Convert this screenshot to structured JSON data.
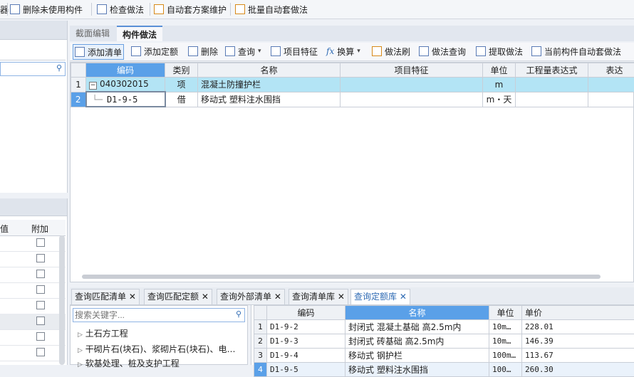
{
  "toolbar": {
    "items": [
      {
        "label": "删除未使用构件",
        "icon": "delete-unused-icon"
      },
      {
        "label": "检查做法",
        "icon": "check-method-icon"
      },
      {
        "label": "自动套方案维护",
        "icon": "auto-plan-icon"
      },
      {
        "label": "批量自动套做法",
        "icon": "batch-auto-icon"
      }
    ],
    "partial_first": "器"
  },
  "left_top": {
    "header": "",
    "search_placeholder": ""
  },
  "left_bottom": {
    "headers": [
      "值",
      "附加"
    ],
    "rows": 9
  },
  "main_tabs": [
    {
      "label": "截面编辑",
      "active": false
    },
    {
      "label": "构件做法",
      "active": true
    }
  ],
  "method_toolbar": [
    {
      "label": "添加清单",
      "icon": "add-list-icon"
    },
    {
      "label": "添加定额",
      "icon": "add-quota-icon"
    },
    {
      "label": "删除",
      "icon": "delete-icon"
    },
    {
      "label": "查询",
      "icon": "query-icon"
    },
    {
      "label": "项目特征",
      "icon": "feature-icon"
    },
    {
      "label": "换算",
      "icon": "fx-icon"
    },
    {
      "label": "做法刷",
      "icon": "brush-icon"
    },
    {
      "label": "做法查询",
      "icon": "method-query-icon"
    },
    {
      "label": "提取做法",
      "icon": "extract-icon"
    },
    {
      "label": "当前构件自动套做法",
      "icon": "auto-apply-icon"
    }
  ],
  "grid": {
    "headers": [
      "编码",
      "类别",
      "名称",
      "项目特征",
      "单位",
      "工程量表达式",
      "表达"
    ],
    "rows": [
      {
        "num": "1",
        "code": "040302015",
        "type": "项",
        "name": "混凝土防撞护栏",
        "feature": "",
        "unit": "m",
        "expr": ""
      },
      {
        "num": "2",
        "code": "D1-9-5",
        "type": "借",
        "name": "移动式 塑料注水围挡",
        "feature": "",
        "unit": "m・天",
        "expr": ""
      }
    ]
  },
  "bottom_tabs": [
    {
      "label": "查询匹配清单",
      "active": false
    },
    {
      "label": "查询匹配定额",
      "active": false
    },
    {
      "label": "查询外部清单",
      "active": false
    },
    {
      "label": "查询清单库",
      "active": false
    },
    {
      "label": "查询定额库",
      "active": true
    }
  ],
  "library": {
    "search_placeholder": "搜索关键字...",
    "tree": [
      "土石方工程",
      "干砌片石(块石)、浆砌片石(块石)、电…",
      "软基处理、桩及支护工程"
    ]
  },
  "quota_table": {
    "headers": [
      "编码",
      "名称",
      "单位",
      "单价"
    ],
    "rows": [
      {
        "num": "1",
        "code": "D1-9-2",
        "name": "封闭式 混凝土基础 高2.5m内",
        "unit": "10m…",
        "price": "228.01"
      },
      {
        "num": "2",
        "code": "D1-9-3",
        "name": "封闭式 砖基础 高2.5m内",
        "unit": "10m…",
        "price": "146.39"
      },
      {
        "num": "3",
        "code": "D1-9-4",
        "name": "移动式 钢护栏",
        "unit": "100m…",
        "price": "113.67"
      },
      {
        "num": "4",
        "code": "D1-9-5",
        "name": "移动式 塑料注水围挡",
        "unit": "100…",
        "price": "260.30"
      }
    ]
  }
}
